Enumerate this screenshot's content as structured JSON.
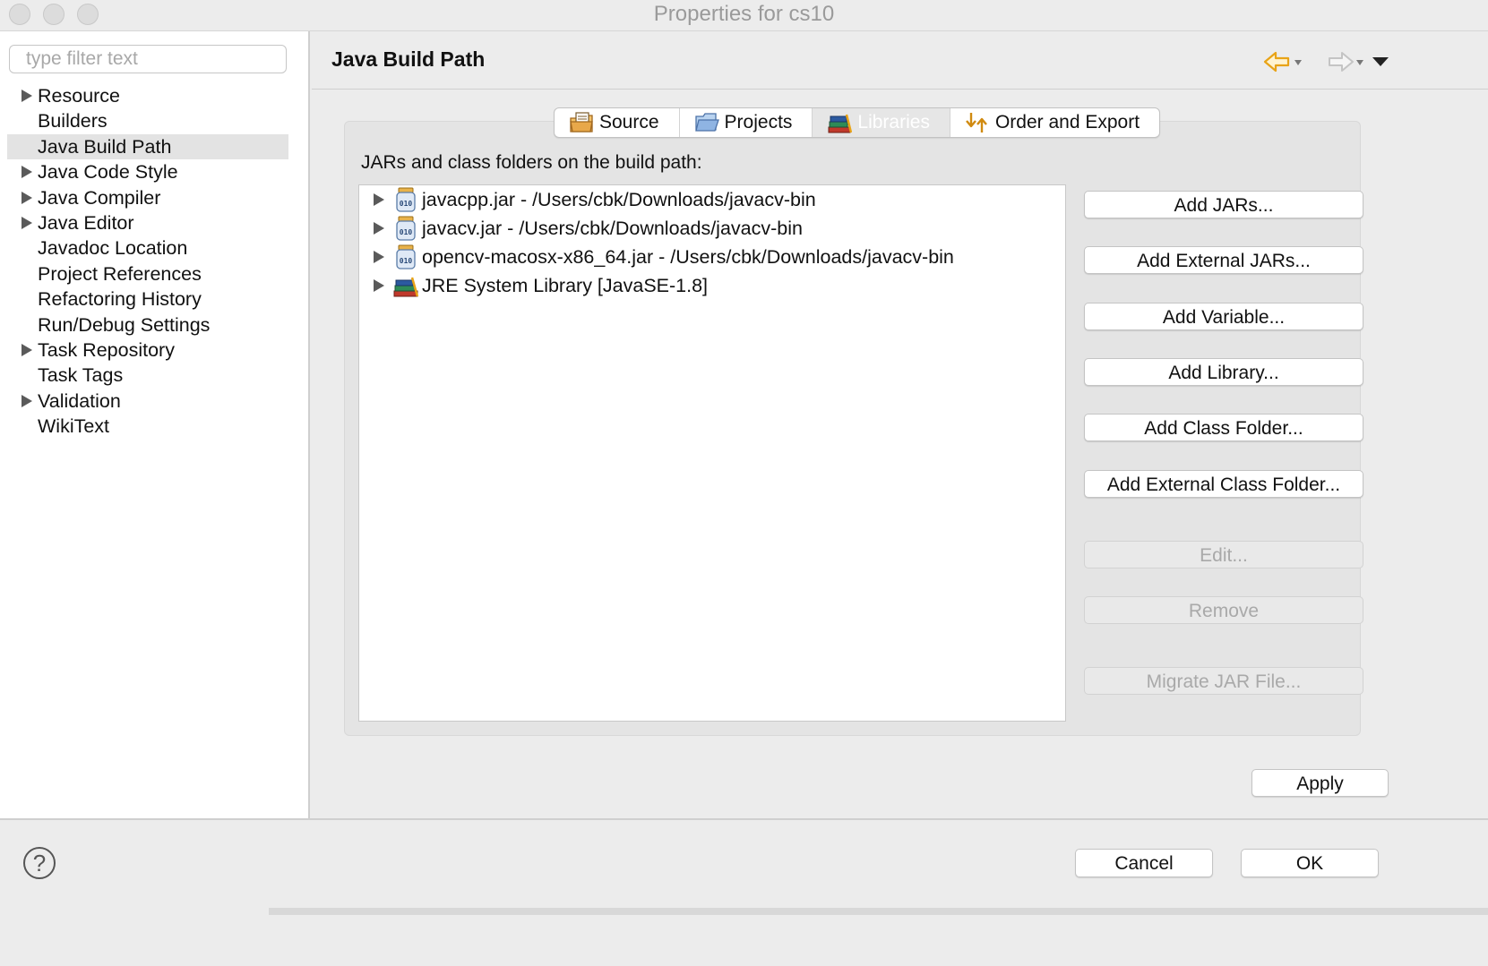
{
  "window": {
    "title": "Properties for cs10"
  },
  "sidebar": {
    "filter_placeholder": "type filter text",
    "items": [
      {
        "label": "Resource",
        "expandable": true
      },
      {
        "label": "Builders",
        "expandable": false
      },
      {
        "label": "Java Build Path",
        "expandable": false,
        "selected": true
      },
      {
        "label": "Java Code Style",
        "expandable": true
      },
      {
        "label": "Java Compiler",
        "expandable": true
      },
      {
        "label": "Java Editor",
        "expandable": true
      },
      {
        "label": "Javadoc Location",
        "expandable": false
      },
      {
        "label": "Project References",
        "expandable": false
      },
      {
        "label": "Refactoring History",
        "expandable": false
      },
      {
        "label": "Run/Debug Settings",
        "expandable": false
      },
      {
        "label": "Task Repository",
        "expandable": true
      },
      {
        "label": "Task Tags",
        "expandable": false
      },
      {
        "label": "Validation",
        "expandable": true
      },
      {
        "label": "WikiText",
        "expandable": false
      }
    ]
  },
  "page": {
    "title": "Java Build Path"
  },
  "tabs": [
    {
      "label": "Source",
      "icon": "source-folder-icon"
    },
    {
      "label": "Projects",
      "icon": "projects-folder-icon"
    },
    {
      "label": "Libraries",
      "icon": "libraries-icon",
      "active": true
    },
    {
      "label": "Order and Export",
      "icon": "order-export-icon"
    }
  ],
  "libraries": {
    "label": "JARs and class folders on the build path:",
    "entries": [
      {
        "label": "javacpp.jar - /Users/cbk/Downloads/javacv-bin",
        "icon": "jar-icon"
      },
      {
        "label": "javacv.jar - /Users/cbk/Downloads/javacv-bin",
        "icon": "jar-icon"
      },
      {
        "label": "opencv-macosx-x86_64.jar - /Users/cbk/Downloads/javacv-bin",
        "icon": "jar-icon"
      },
      {
        "label": "JRE System Library [JavaSE-1.8]",
        "icon": "library-icon"
      }
    ],
    "buttons": {
      "add_jars": "Add JARs...",
      "add_external_jars": "Add External JARs...",
      "add_variable": "Add Variable...",
      "add_library": "Add Library...",
      "add_class_folder": "Add Class Folder...",
      "add_external_class_folder": "Add External Class Folder...",
      "edit": "Edit...",
      "remove": "Remove",
      "migrate_jar": "Migrate JAR File..."
    }
  },
  "footer": {
    "apply": "Apply",
    "cancel": "Cancel",
    "ok": "OK",
    "help": "?"
  },
  "colors": {
    "accent_arrow": "#e8a317",
    "disabled_text": "#a9a9a9",
    "selection": "#e3e3e3"
  }
}
